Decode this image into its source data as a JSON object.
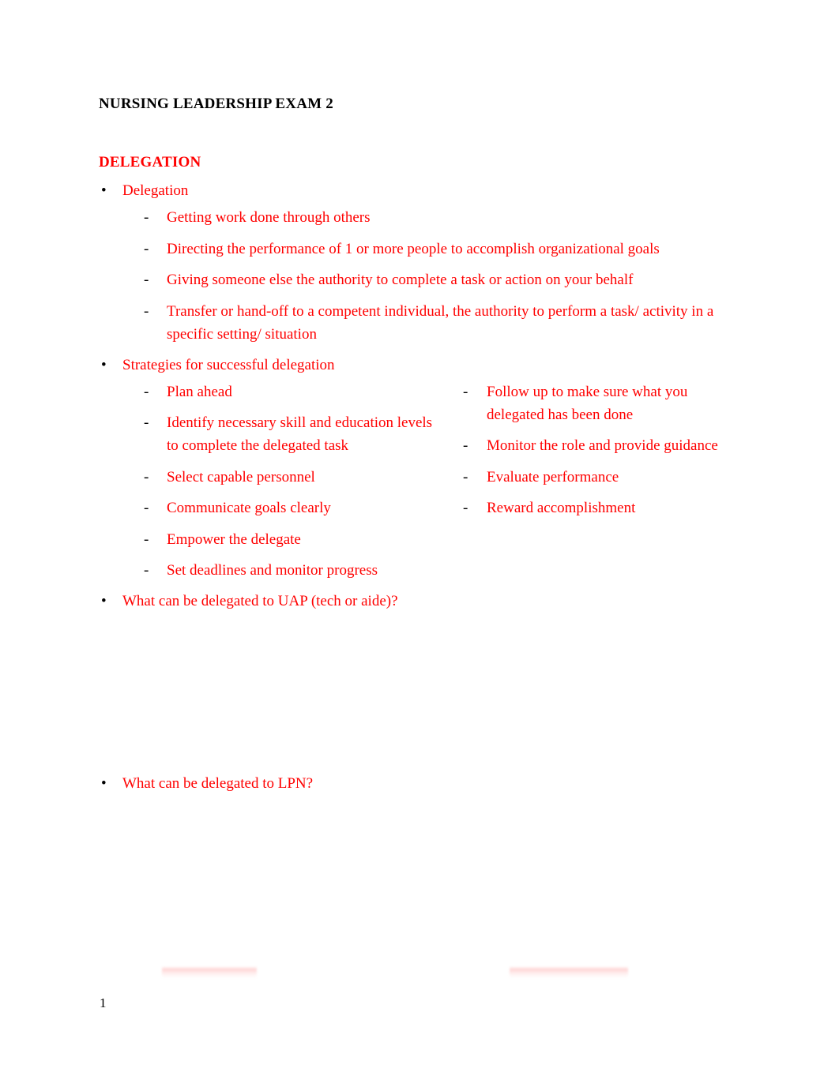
{
  "document": {
    "title": "NURSING LEADERSHIP EXAM 2",
    "page_number": "1",
    "text_color_body": "#FF0000",
    "text_color_heading": "#000000"
  },
  "section": {
    "heading": "DELEGATION"
  },
  "bullets": {
    "delegation": {
      "label": "Delegation",
      "marker": "bullet-dot",
      "sub_items": [
        "Getting work done through others",
        "Directing the performance of 1 or more people to accomplish organizational goals",
        "Giving someone else the authority to complete a task or action on your behalf",
        "Transfer or hand-off to a competent individual, the authority to perform a task/ activity in a specific setting/ situation"
      ]
    },
    "strategies": {
      "label": "Strategies for successful delegation",
      "marker": "bullet-dot",
      "column_left": [
        "Plan ahead",
        "Identify necessary skill and education levels to complete the delegated task",
        "Select capable personnel",
        "Communicate goals clearly",
        "Empower the delegate",
        "Set deadlines and monitor progress"
      ],
      "column_right": [
        "Follow up to make sure what you delegated has been done",
        "Monitor the role and provide guidance",
        "Evaluate performance",
        "Reward accomplishment"
      ]
    },
    "uap_question": {
      "label": "What can be delegated to UAP (tech or aide)?",
      "marker": "bullet-dot"
    },
    "lpn_question": {
      "label": "What can be delegated to LPN?",
      "marker": "bullet-dot"
    }
  },
  "markers": {
    "dot": "•",
    "dash": "-"
  }
}
